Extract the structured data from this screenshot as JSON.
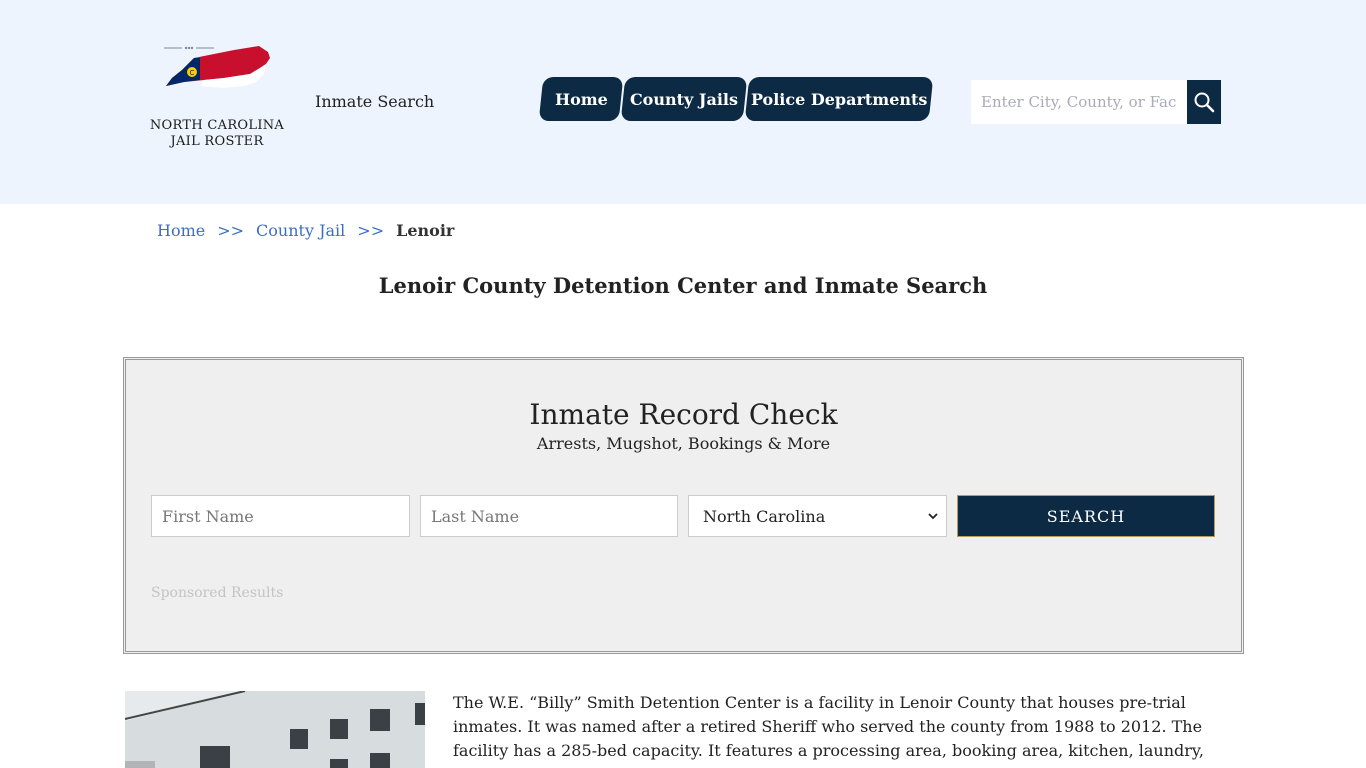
{
  "header": {
    "logo_line1": "NORTH CAROLINA",
    "logo_line2": "JAIL ROSTER",
    "inmate_search_link": "Inmate Search",
    "nav": [
      "Home",
      "County Jails",
      "Police Departments"
    ],
    "search_placeholder": "Enter City, County, or Facility",
    "icons": {
      "search": "search-icon",
      "logo": "north-carolina-state-icon"
    },
    "colors": {
      "header_bg": "#eef4fd",
      "nav_bg": "#0c2a44",
      "flag_red": "#c8102e",
      "flag_blue": "#002868"
    }
  },
  "breadcrumb": {
    "items": [
      "Home",
      "County Jail"
    ],
    "separator": ">>",
    "current": "Lenoir"
  },
  "page_title": "Lenoir County Detention Center and Inmate Search",
  "record_check": {
    "title": "Inmate Record Check",
    "subtitle": "Arrests, Mugshot, Bookings & More",
    "first_name_placeholder": "First Name",
    "last_name_placeholder": "Last Name",
    "state_selected": "North Carolina",
    "search_button": "SEARCH",
    "sponsored": "Sponsored Results"
  },
  "content": {
    "description": "The W.E. “Billy” Smith Detention Center is a facility in Lenoir County that houses pre-trial inmates. It was named after a retired Sheriff who served the county from 1988 to 2012. The facility has a 285-bed capacity. It features a processing area, booking area, kitchen, laundry, medical wing, and trustee"
  }
}
